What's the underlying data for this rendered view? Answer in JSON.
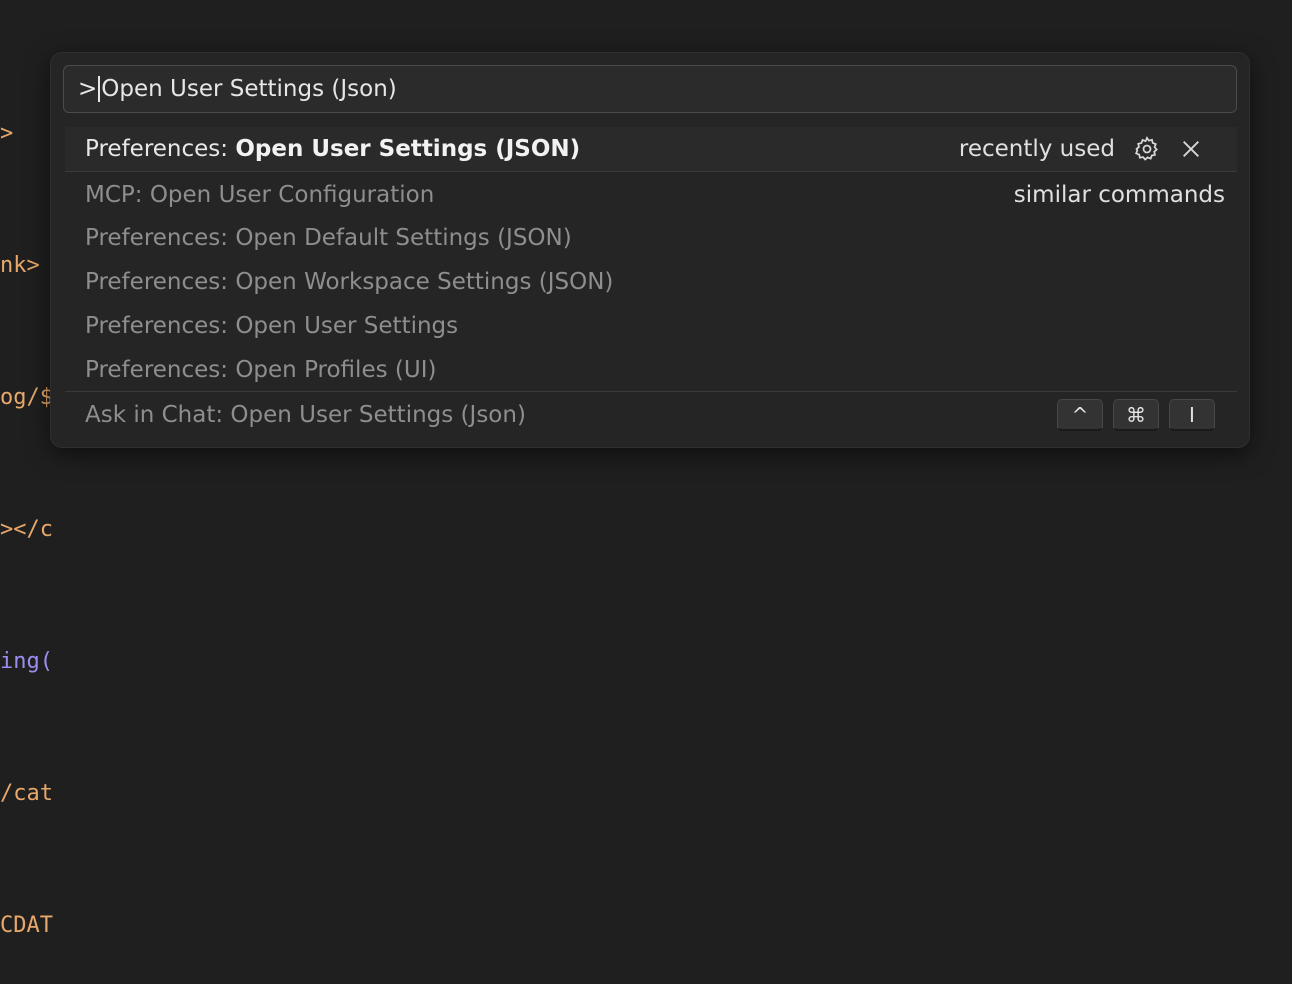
{
  "editor_fragments": [
    {
      "text": ">",
      "color": "#e8a86b"
    },
    {
      "text": "nk>",
      "color": "#e8a86b"
    },
    {
      "text": "og/$",
      "color": "#e8a86b",
      "accent": "#e0566b"
    },
    {
      "text": "></c",
      "color": "#e8a86b"
    },
    {
      "text": "ing(",
      "color": "#9b8ef0",
      "accent": "#4fb3e8"
    },
    {
      "text": "/cat",
      "color": "#e8a86b"
    },
    {
      "text": "CDAT",
      "color": "#e8a86b"
    }
  ],
  "quick_input": {
    "prefix": ">",
    "value": "Open User Settings (Json)"
  },
  "results": {
    "selected": {
      "prefix": "Preferences: ",
      "bold": "Open User Settings (JSON)",
      "badge": "recently used",
      "gear_icon": "gear-icon",
      "close_icon": "close-icon"
    },
    "items": [
      {
        "label": "MCP: Open User Configuration",
        "badge": "similar commands"
      },
      {
        "label": "Preferences: Open Default Settings (JSON)",
        "badge": ""
      },
      {
        "label": "Preferences: Open Workspace Settings (JSON)",
        "badge": ""
      },
      {
        "label": "Preferences: Open User Settings",
        "badge": ""
      },
      {
        "label": "Preferences: Open Profiles (UI)",
        "badge": ""
      }
    ],
    "ask_chat": {
      "label": "Ask in Chat: Open User Settings (Json)",
      "keys": [
        "^",
        "⌘",
        "I"
      ]
    }
  },
  "colors": {
    "background": "#1f1f1f",
    "palette": "#252526",
    "selected_row": "#2a2a2a"
  }
}
